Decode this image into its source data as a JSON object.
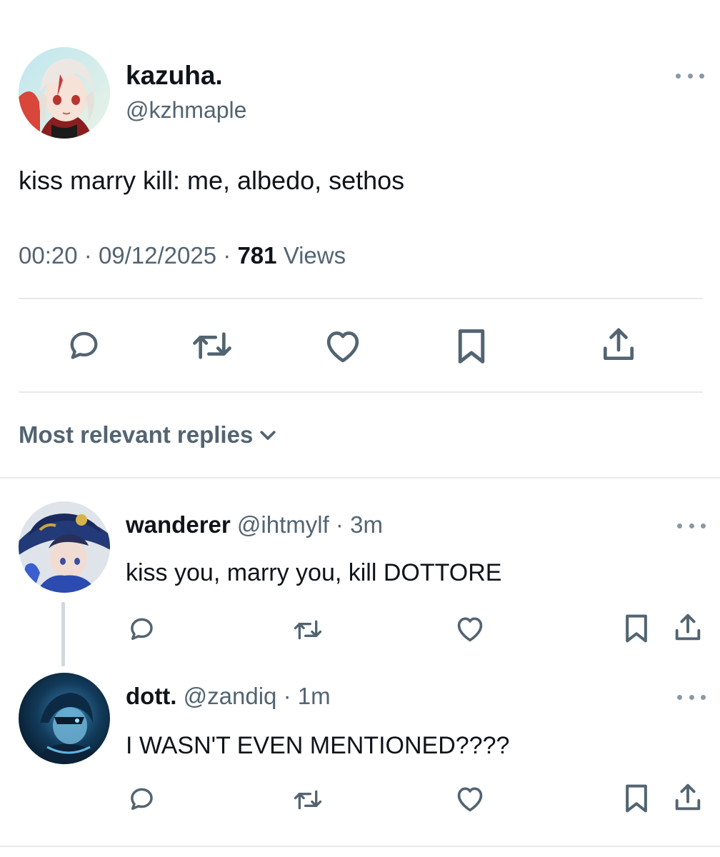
{
  "tweet": {
    "author": {
      "name": "kazuha.",
      "handle": "@kzhmaple"
    },
    "text": "kiss marry kill: me, albedo, sethos",
    "time": "00:20",
    "date": "09/12/2025",
    "views_count": "781",
    "views_label": "Views",
    "separator": "·"
  },
  "replies_sort": {
    "label": "Most relevant replies"
  },
  "replies": [
    {
      "name": "wanderer",
      "handle": "@ihtmylf",
      "age": "3m",
      "text": "kiss you, marry you, kill DOTTORE"
    },
    {
      "name": "dott.",
      "handle": "@zandiq",
      "age": "1m",
      "text": "I WASN'T EVEN MENTIONED????"
    }
  ],
  "colors": {
    "text": "#0f1419",
    "muted": "#536471",
    "divider": "#e6e9eb",
    "thread_line": "#cfd9de"
  },
  "icons": [
    "reply-icon",
    "retweet-icon",
    "like-icon",
    "bookmark-icon",
    "share-icon",
    "more-icon",
    "chevron-down-icon"
  ]
}
